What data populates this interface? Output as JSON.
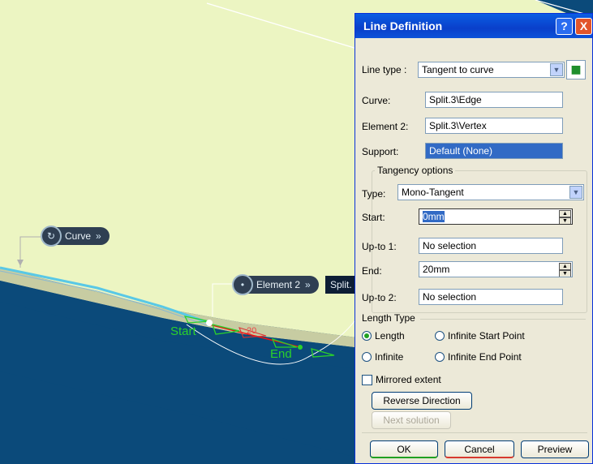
{
  "viewport": {
    "labels": {
      "curve": "Curve",
      "curve_chevron": "»",
      "element2": "Element 2",
      "element2_chevron": "»",
      "split": "Split.",
      "start": "Start",
      "end": "End",
      "dim": "20"
    }
  },
  "dialog": {
    "title": "Line Definition",
    "help_label": "?",
    "close_label": "X",
    "line_type": {
      "label": "Line type :",
      "value": "Tangent to curve"
    },
    "curve": {
      "label": "Curve:",
      "value": "Split.3\\Edge"
    },
    "element2": {
      "label": "Element 2:",
      "value": "Split.3\\Vertex"
    },
    "support": {
      "label": "Support:",
      "value": "Default (None)"
    },
    "tangency": {
      "caption": "Tangency options",
      "type": {
        "label": "Type:",
        "value": "Mono-Tangent"
      },
      "start": {
        "label": "Start:",
        "value": "0mm"
      },
      "upto1": {
        "label": "Up-to 1:",
        "value": "No selection"
      },
      "end": {
        "label": "End:",
        "value": "20mm"
      },
      "upto2": {
        "label": "Up-to 2:",
        "value": "No selection"
      }
    },
    "length_type": {
      "caption": "Length Type",
      "options": [
        "Length",
        "Infinite Start Point",
        "Infinite",
        "Infinite End Point"
      ],
      "selected": "Length"
    },
    "mirrored_extent": {
      "label": "Mirrored extent",
      "checked": false
    },
    "reverse_direction": "Reverse Direction",
    "next_solution": "Next solution",
    "ok": "OK",
    "cancel": "Cancel",
    "preview": "Preview"
  }
}
